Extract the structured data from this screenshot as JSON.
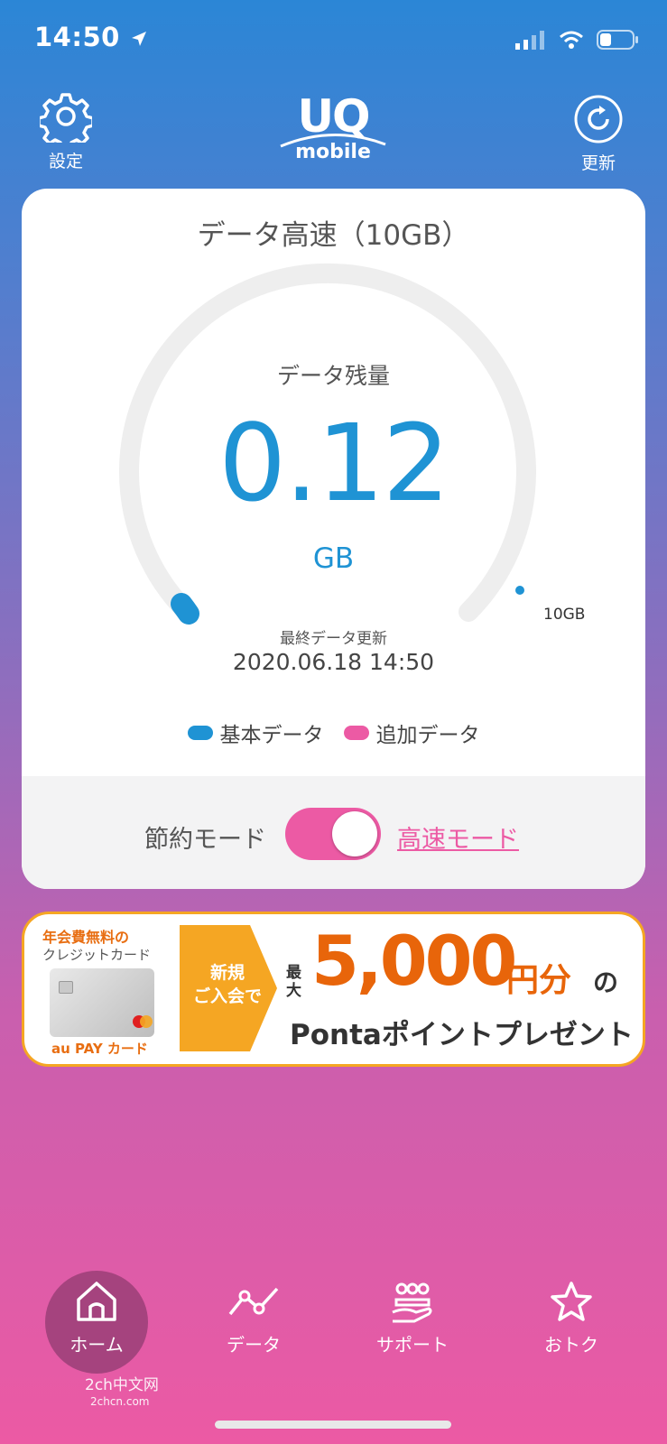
{
  "status_bar": {
    "time": "14:50"
  },
  "header": {
    "settings_label": "設定",
    "logo_top": "UQ",
    "logo_bottom": "mobile",
    "refresh_label": "更新"
  },
  "card": {
    "title": "データ高速（10GB）",
    "remaining_label": "データ残量",
    "remaining_value": "0.12",
    "remaining_unit": "GB",
    "max_label": "10GB",
    "usage_fraction_remaining": 0.012,
    "last_update_label": "最終データ更新",
    "last_update_value": "2020.06.18 14:50",
    "legend": [
      {
        "label": "基本データ",
        "color": "#1f93d4"
      },
      {
        "label": "追加データ",
        "color": "#ec5aa4"
      }
    ],
    "mode": {
      "off_label": "節約モード",
      "on_label": "高速モード",
      "enabled": true
    }
  },
  "banner": {
    "line1": "年会費無料の",
    "line2": "クレジットカード",
    "aupay": "au PAY カード",
    "new_join": "新規\nご入会で",
    "max": "最大",
    "amount": "5,000",
    "yen": "円分",
    "no": "の",
    "ponta": "Pontaポイントプレゼント"
  },
  "nav": [
    {
      "label": "ホーム",
      "icon": "home-icon",
      "active": true
    },
    {
      "label": "データ",
      "icon": "chart-line-icon",
      "active": false
    },
    {
      "label": "サポート",
      "icon": "support-icon",
      "active": false
    },
    {
      "label": "おトク",
      "icon": "star-icon",
      "active": false
    }
  ],
  "watermark": {
    "line1": "2ch中文网",
    "line2": "2chcn.com"
  },
  "colors": {
    "accent_blue": "#1f93d4",
    "accent_pink": "#ec5aa4",
    "banner_orange": "#e8650a"
  }
}
